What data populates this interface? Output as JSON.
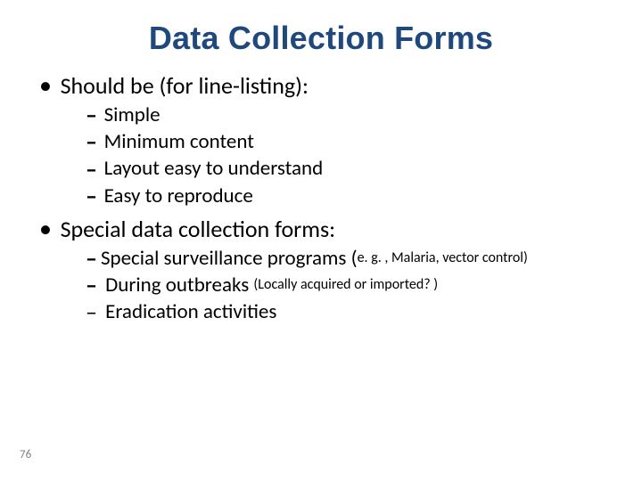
{
  "title": "Data Collection Forms",
  "bullets": {
    "b1": {
      "label": "Should be (for line-listing):",
      "items": [
        "Simple",
        "Minimum content",
        "Layout easy to understand",
        "Easy to reproduce"
      ]
    },
    "b2": {
      "label": "Special data collection forms:",
      "items": [
        {
          "main": "Special surveillance programs (",
          "small": "e. g. , Malaria, vector control)"
        },
        {
          "main": " During outbreaks ",
          "small": "(Locally acquired or imported? )"
        },
        {
          "main": " Eradication activities",
          "small": ""
        }
      ]
    }
  },
  "page_number": "76"
}
